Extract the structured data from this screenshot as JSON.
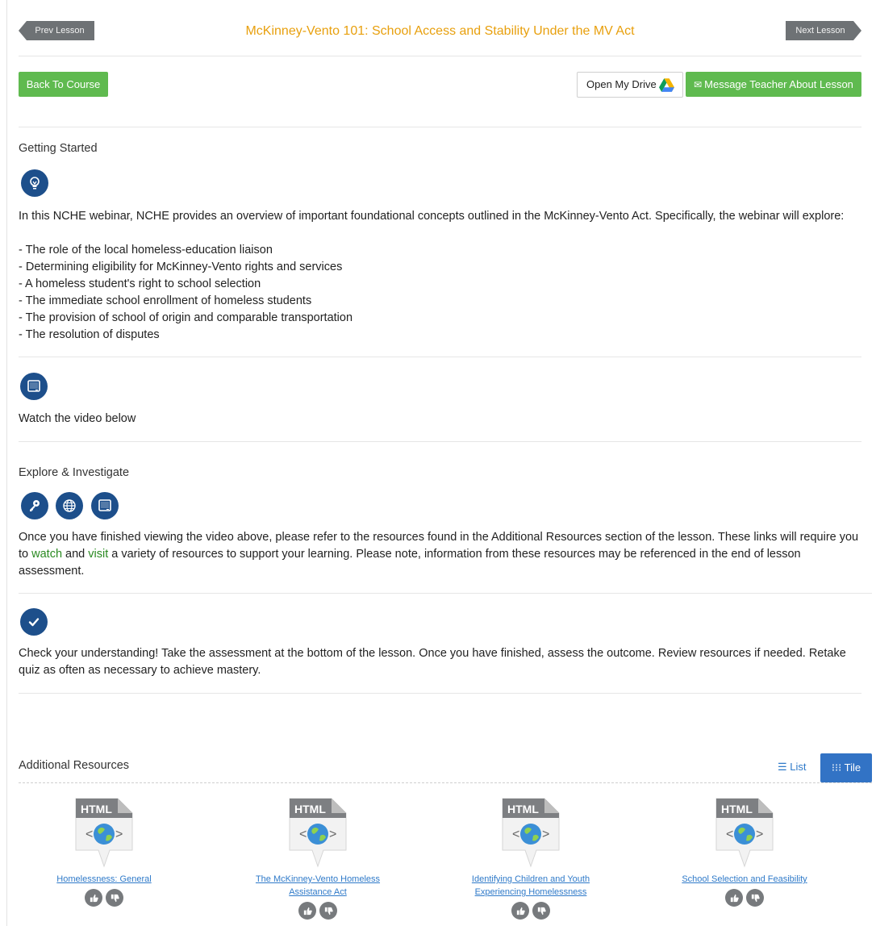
{
  "nav": {
    "prev_label": "Prev Lesson",
    "next_label": "Next Lesson",
    "lesson_title": "McKinney-Vento 101: School Access and Stability Under the MV Act"
  },
  "actions": {
    "back_label": "Back To Course",
    "drive_label": "Open My Drive",
    "message_label": "Message Teacher About Lesson"
  },
  "getting_started": {
    "title": "Getting Started",
    "icon": "lightbulb-icon",
    "intro": "In this NCHE webinar, NCHE provides an overview of important foundational concepts outlined in the McKinney-Vento Act. Specifically, the webinar will explore:",
    "bullets": [
      "- The role of the local homeless-education liaison",
      "- Determining eligibility for McKinney-Vento rights and services",
      "- A homeless student's right to school selection",
      "- The immediate school enrollment of homeless students",
      "- The provision of school of origin and comparable transportation",
      "- The resolution of disputes"
    ]
  },
  "video": {
    "icon": "monitor-icon",
    "text": "Watch the video below"
  },
  "explore": {
    "title": "Explore & Investigate",
    "icons": [
      "key-icon",
      "globe-icon",
      "monitor-icon"
    ],
    "text_a": "Once you have finished viewing the video above, please refer to the resources found in the Additional Resources section of the lesson. These links will require you to ",
    "watch": "watch",
    "text_b": " and ",
    "visit": "visit",
    "text_c": " a variety of resources to support your learning. Please note, information from these resources may be referenced in the end of lesson assessment."
  },
  "check": {
    "icon": "checkmark-icon",
    "text": "Check your understanding! Take the assessment at the bottom of the lesson. Once you have finished, assess the outcome.  Review resources if needed.  Retake quiz as often as necessary to achieve mastery."
  },
  "resources": {
    "title": "Additional Resources",
    "list_label": "List",
    "tile_label": "Tile",
    "file_type": "HTML",
    "items": [
      {
        "title": "Homelessness: General"
      },
      {
        "title": "The McKinney-Vento Homeless Assistance Act"
      },
      {
        "title": "Identifying Children and Youth Experiencing Homelessness"
      },
      {
        "title": "School Selection and Feasibility"
      }
    ]
  },
  "colors": {
    "accent_orange": "#e8a00e",
    "green": "#5fba4f",
    "navy": "#1d4f8b",
    "blue": "#3273c5"
  }
}
